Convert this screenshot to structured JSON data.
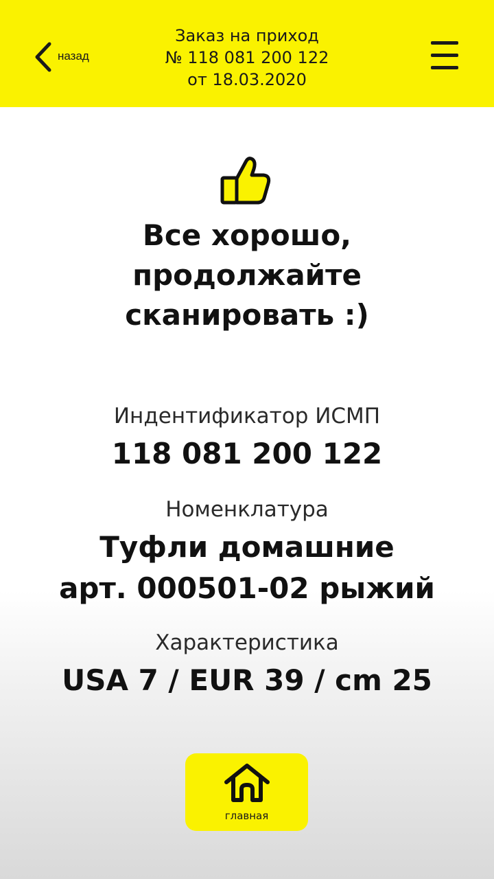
{
  "header": {
    "back_label": "назад",
    "title_line1": "Заказ на приход",
    "title_line2": "№ 118 081 200 122",
    "title_line3": "от 18.03.2020",
    "background_color": "#faf200"
  },
  "status": {
    "icon": "thumbs-up-icon",
    "message_line1": "Все хорошо,",
    "message_line2": "продолжайте",
    "message_line3": "сканировать :)"
  },
  "details": {
    "identifier_label": "Индентификатор ИСМП",
    "identifier_value": "118 081 200 122",
    "nomenclature_label": "Номенклатура",
    "nomenclature_line1": "Туфли домашние",
    "nomenclature_line2": "арт. 000501-02 рыжий",
    "characteristic_label": "Характеристика",
    "characteristic_value": "USA 7 / EUR 39 / cm 25"
  },
  "footer": {
    "home_label": "главная",
    "home_icon": "home-icon"
  }
}
